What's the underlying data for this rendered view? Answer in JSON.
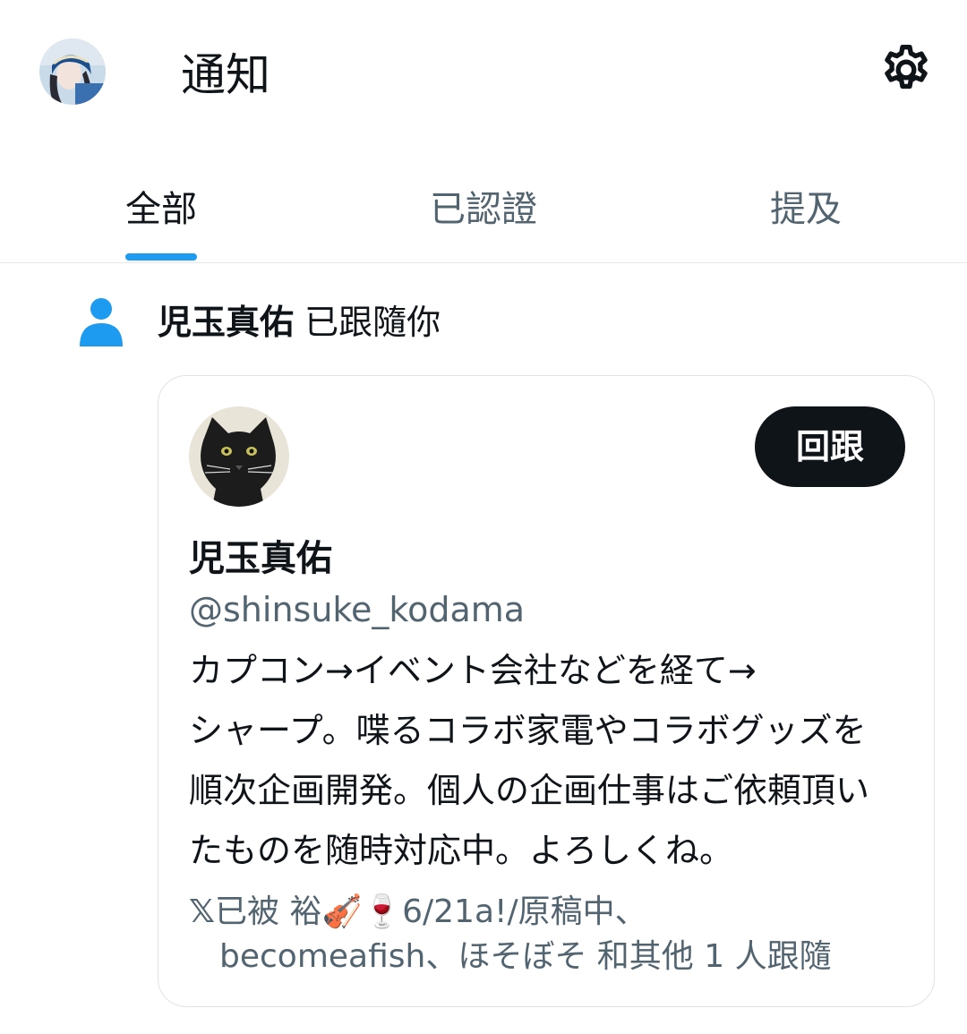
{
  "header": {
    "title": "通知"
  },
  "tabs": [
    {
      "label": "全部",
      "active": true
    },
    {
      "label": "已認證",
      "active": false
    },
    {
      "label": "提及",
      "active": false
    }
  ],
  "notification": {
    "name": "児玉真佑",
    "action": "已跟隨你"
  },
  "user_card": {
    "display_name": "児玉真佑",
    "handle": "@shinsuke_kodama",
    "follow_back_label": "回跟",
    "bio_lines": [
      "カプコン→イベント会社などを経て→",
      "シャープ。喋るコラボ家電やコラボグッズを",
      "順次企画開発。個人の企画仕事はご依頼頂い",
      "たものを随時対応中。よろしくね。"
    ],
    "followed_by": {
      "x_icon": "𝕏",
      "line1": "已被 裕🎻🍷6/21a!/原稿中、",
      "line2": "becomeafish、ほそぼそ 和其他 1 人跟隨"
    }
  },
  "colors": {
    "accent": "#1d9bf0",
    "text": "#0f1419",
    "secondary_text": "#536471",
    "button_bg": "#0f1419"
  },
  "icons": {
    "settings": "gear-icon",
    "follow_notification": "person-icon"
  }
}
